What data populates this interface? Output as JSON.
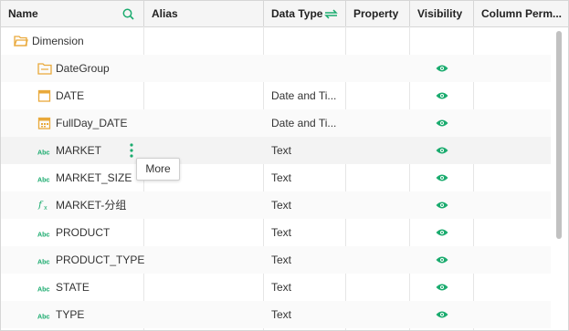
{
  "columns": {
    "name": "Name",
    "alias": "Alias",
    "data_type": "Data Type",
    "property": "Property",
    "visibility": "Visibility",
    "column_perm": "Column Perm..."
  },
  "tree": {
    "root_label": "Dimension",
    "rows": [
      {
        "name": "DateGroup",
        "data_type": "",
        "icon": "folder-icon"
      },
      {
        "name": "DATE",
        "data_type": "Date and Ti...",
        "icon": "calendar-icon"
      },
      {
        "name": "FullDay_DATE",
        "data_type": "Date and Ti...",
        "icon": "calendar-grid-icon"
      },
      {
        "name": "MARKET",
        "data_type": "Text",
        "icon": "text-abc-icon"
      },
      {
        "name": "MARKET_SIZE",
        "data_type": "Text",
        "icon": "text-abc-icon"
      },
      {
        "name": "MARKET-分组",
        "data_type": "Text",
        "icon": "formula-fx-icon"
      },
      {
        "name": "PRODUCT",
        "data_type": "Text",
        "icon": "text-abc-icon"
      },
      {
        "name": "PRODUCT_TYPE",
        "data_type": "Text",
        "icon": "text-abc-icon"
      },
      {
        "name": "STATE",
        "data_type": "Text",
        "icon": "text-abc-icon"
      },
      {
        "name": "TYPE",
        "data_type": "Text",
        "icon": "text-abc-icon"
      }
    ]
  },
  "tooltip": {
    "label": "More"
  },
  "colors": {
    "accent": "#1aab6e",
    "folder": "#e9a93b",
    "header_bg": "#f5f5f5"
  }
}
